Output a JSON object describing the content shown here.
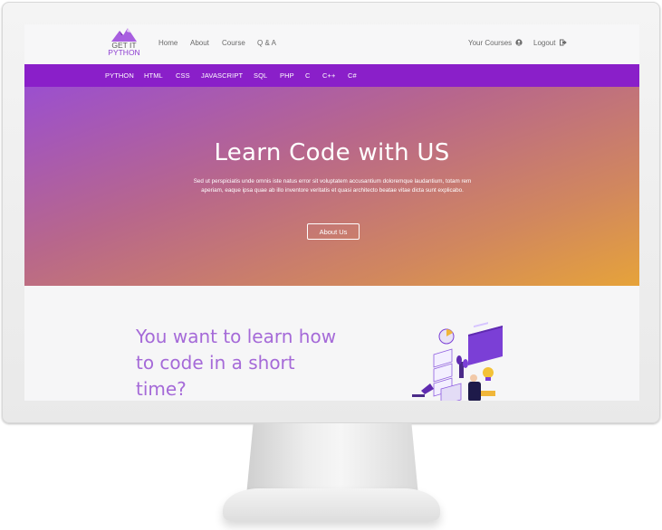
{
  "header": {
    "logo": {
      "line1": "GET IT",
      "line2": "PYTHON"
    },
    "nav": [
      "Home",
      "About",
      "Course",
      "Q & A"
    ],
    "right": {
      "courses": "Your Courses",
      "logout": "Logout"
    }
  },
  "langbar": [
    "PYTHON",
    "HTML",
    "CSS",
    "JAVASCRIPT",
    "SQL",
    "PHP",
    "C",
    "C++",
    "C#"
  ],
  "hero": {
    "title": "Learn Code with US",
    "text": "Sed ut perspiciatis unde omnis iste natus error sit voluptatem accusantium doloremque laudantium, totam rem aperiam, eaque ipsa quae ab illo inventore veritatis et quasi architecto beatae vitae dicta sunt explicabo.",
    "button": "About Us"
  },
  "section": {
    "heading": "You want to learn how to code in a short time?"
  },
  "icons": {
    "user_circle": "user-circle-icon",
    "logout": "sign-out-icon"
  },
  "colors": {
    "brand_purple": "#8a1fc9",
    "heading_purple": "#a56ad8",
    "gradient_start": "#9b4fcf",
    "gradient_end": "#e6a33a"
  }
}
